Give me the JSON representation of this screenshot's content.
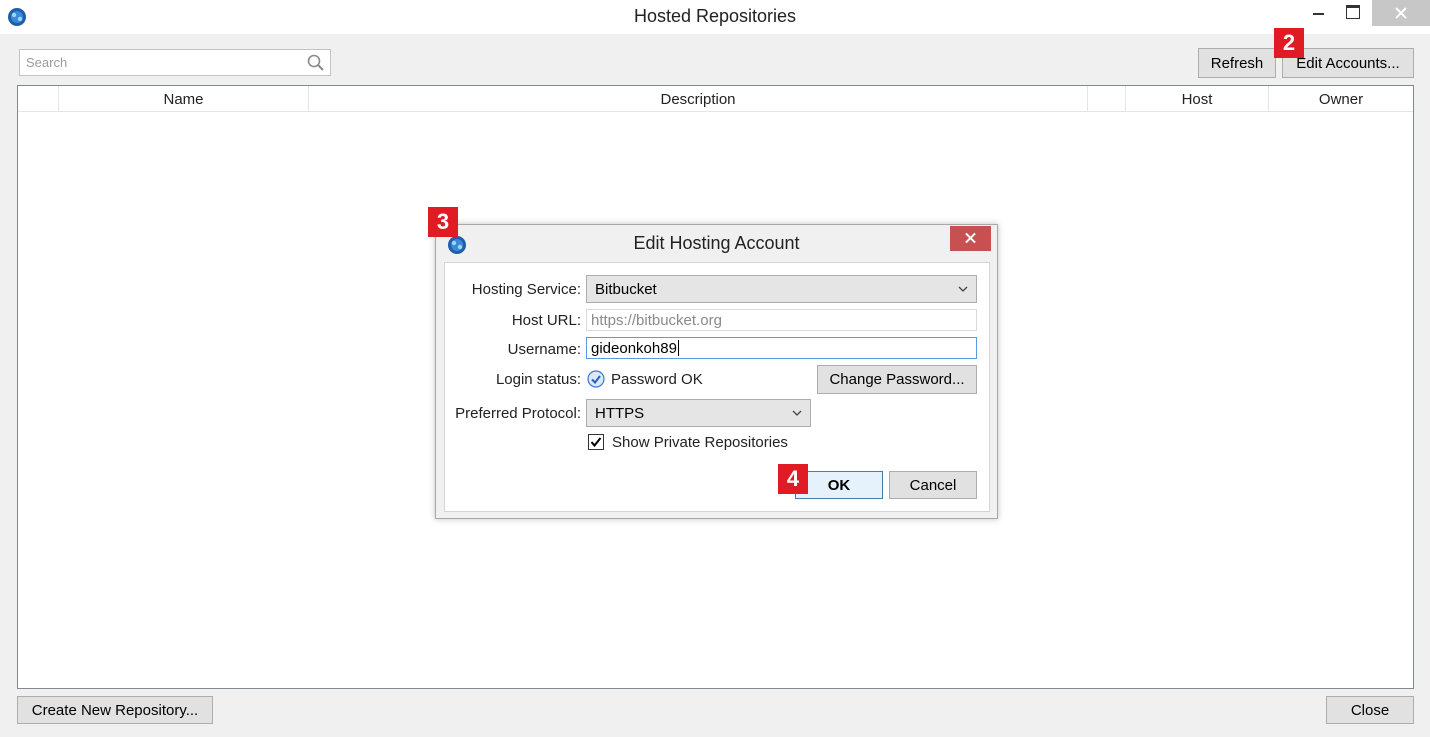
{
  "window": {
    "title": "Hosted Repositories"
  },
  "toolbar": {
    "search_placeholder": "Search",
    "refresh_label": "Refresh",
    "edit_accounts_label": "Edit Accounts..."
  },
  "table": {
    "columns": [
      "",
      "Name",
      "Description",
      "",
      "Host",
      "Owner"
    ],
    "rows": []
  },
  "footer": {
    "create_label": "Create New Repository...",
    "close_label": "Close"
  },
  "markers": {
    "m2": "2",
    "m3": "3",
    "m4": "4"
  },
  "dialog": {
    "title": "Edit Hosting Account",
    "hosting_service_label": "Hosting Service:",
    "hosting_service_value": "Bitbucket",
    "host_url_label": "Host URL:",
    "host_url_value": "https://bitbucket.org",
    "username_label": "Username:",
    "username_value": "gideonkoh89",
    "login_status_label": "Login status:",
    "login_status_value": "Password OK",
    "change_password_label": "Change Password...",
    "protocol_label": "Preferred Protocol:",
    "protocol_value": "HTTPS",
    "show_private_label": "Show Private Repositories",
    "show_private_checked": true,
    "ok_label": "OK",
    "cancel_label": "Cancel"
  },
  "colors": {
    "marker_red": "#e01b24",
    "dialog_close_red": "#c75050",
    "focus_blue": "#569de5",
    "status_ok_blue": "#3a78c9"
  },
  "icons": {
    "app": "sourcetree-app-icon",
    "search": "search-icon",
    "status": "check-circle-icon"
  }
}
